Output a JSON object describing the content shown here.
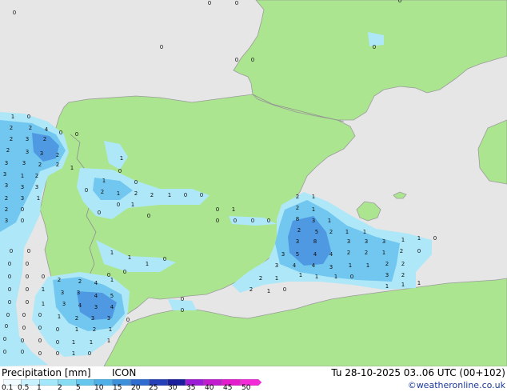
{
  "footer": {
    "title": "Precipitation [mm]",
    "model": "ICON",
    "valid": "Tu 28-10-2025 03..06 UTC (00+102)",
    "credit": "©weatheronline.co.uk"
  },
  "colorbar": {
    "labels": [
      "0.1",
      "0.5",
      "1",
      "2",
      "5",
      "10",
      "15",
      "20",
      "25",
      "30",
      "35",
      "40",
      "45",
      "50"
    ],
    "colors": [
      "#f0fbff",
      "#c8f2ff",
      "#a3e7fb",
      "#86dcf3",
      "#65c7ee",
      "#4fb0e8",
      "#3c8fdb",
      "#2f6cd0",
      "#243fb8",
      "#1a1e9c",
      "#9b1cd6",
      "#c21ccf",
      "#e21ccc",
      "#f22ad8"
    ]
  },
  "map": {
    "colors": {
      "sea": "#e6e6e6",
      "land": "#abe58f",
      "coast": "#9b9b9b",
      "border": "#909090",
      "light_precip": "#aee8f8",
      "med_precip": "#72c7f0",
      "heavy_precip": "#4f98e2"
    },
    "value_labels": [
      "0",
      "1",
      "2",
      "3",
      "4",
      "5",
      "7",
      "8"
    ]
  }
}
